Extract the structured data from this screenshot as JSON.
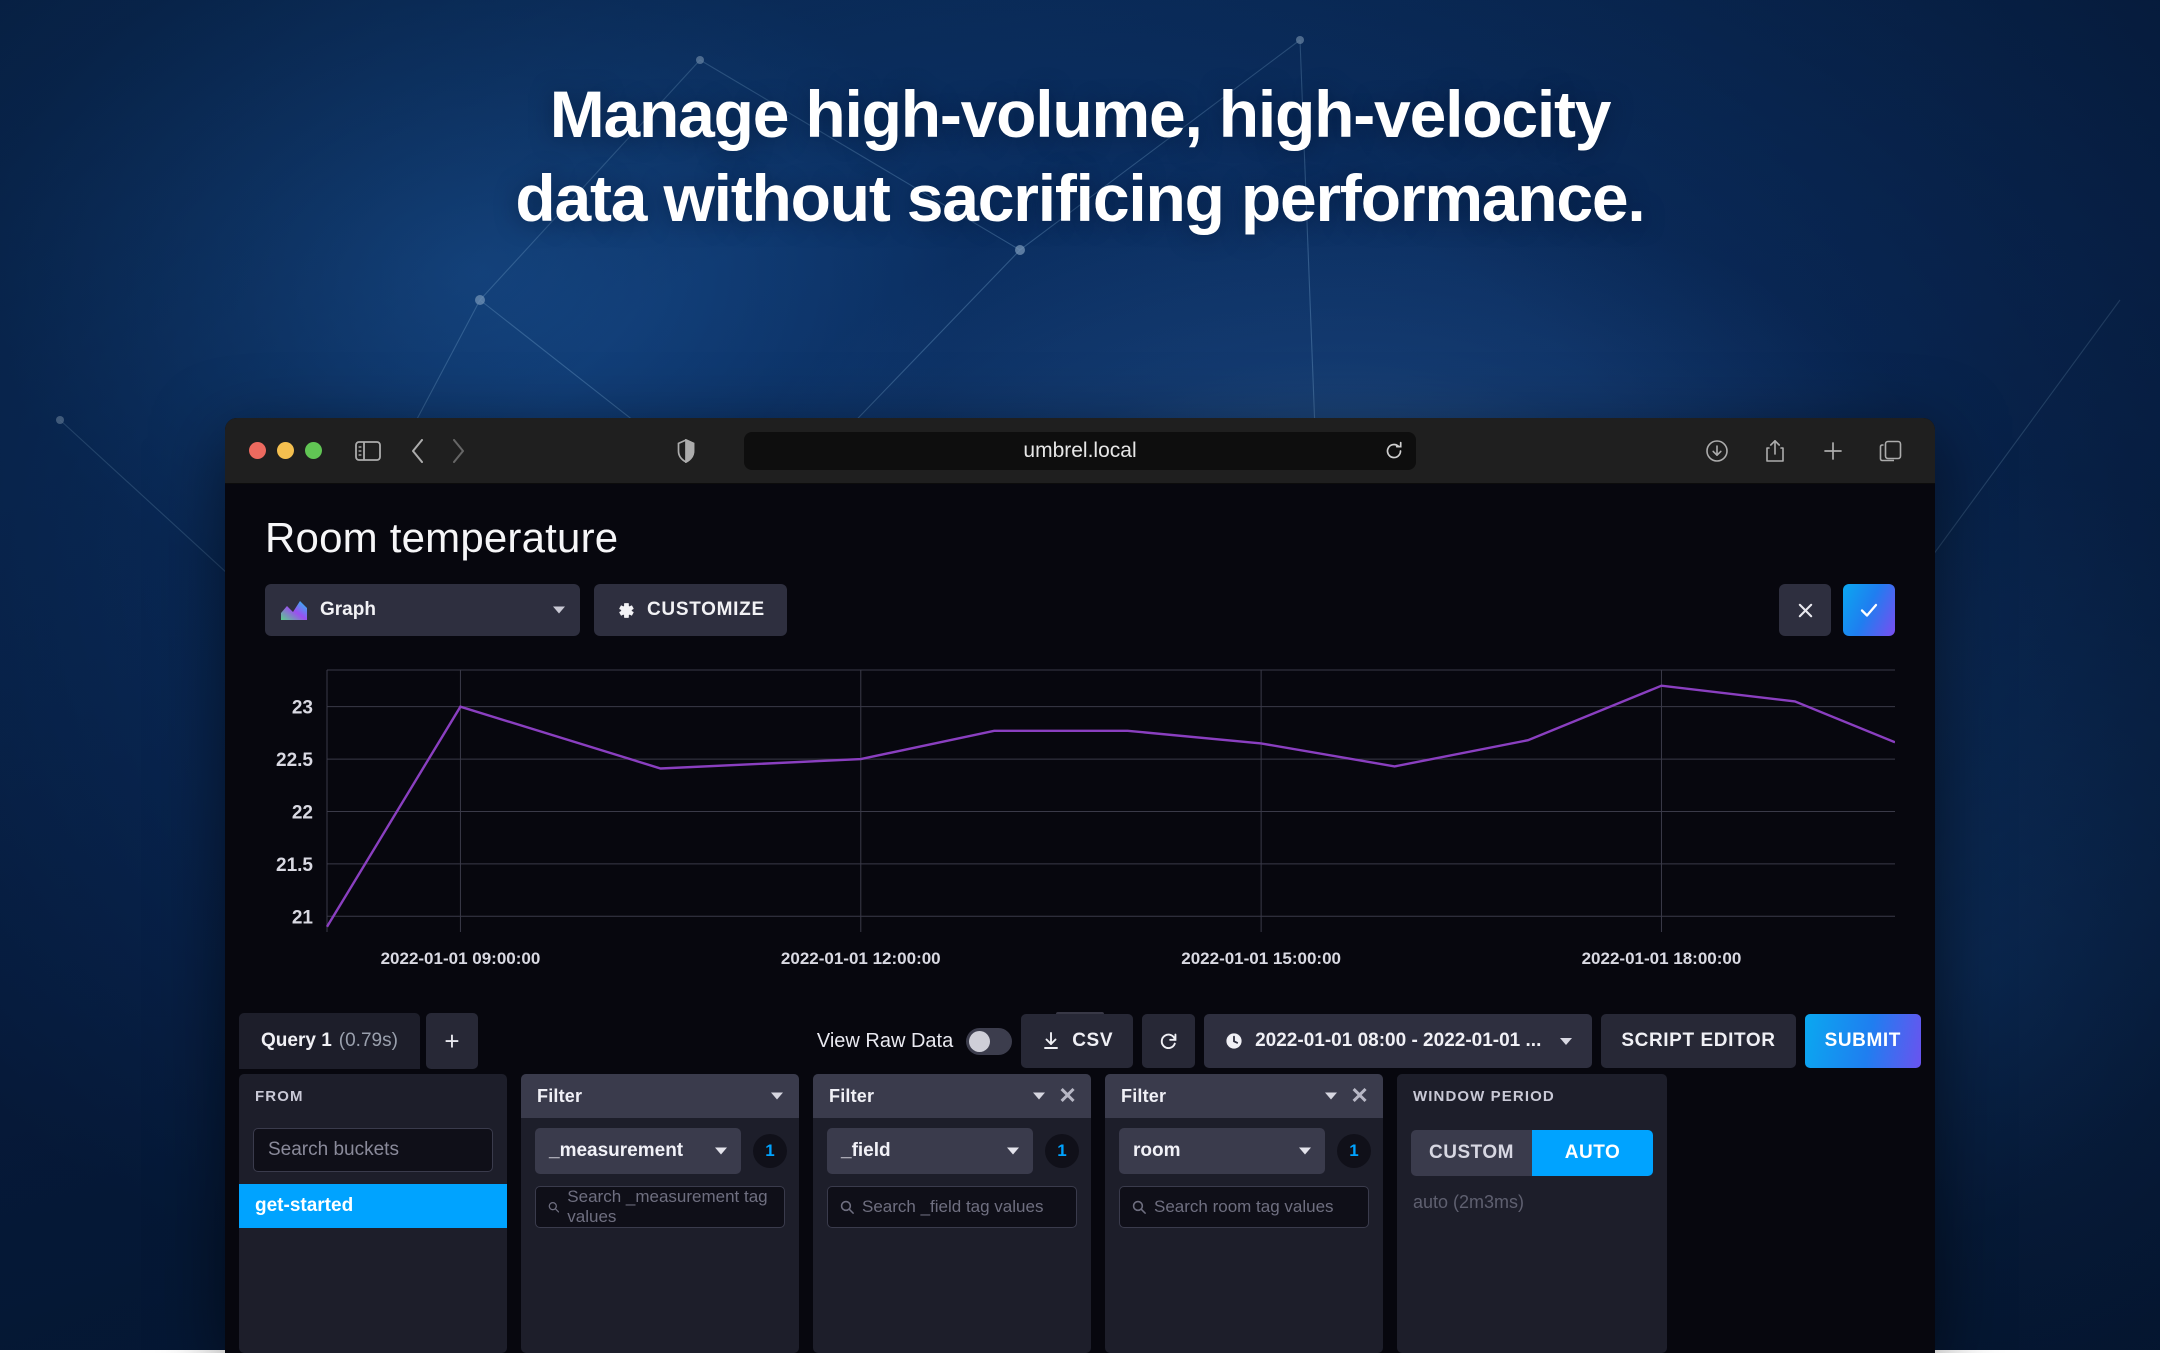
{
  "hero": {
    "headline_line1": "Manage high-volume, high-velocity",
    "headline_line2": "data without sacrificing performance."
  },
  "browser": {
    "url": "umbrel.local",
    "icons": {
      "sidebar": "sidebar-toggle-icon",
      "back": "back-arrow-icon",
      "forward": "forward-arrow-icon",
      "shield": "shield-icon",
      "reload": "reload-icon",
      "downloads": "downloads-icon",
      "share": "share-icon",
      "newtab": "plus-icon",
      "tabs": "tab-overview-icon"
    }
  },
  "app": {
    "page_title": "Room temperature",
    "visualization_type": "Graph",
    "customize_label": "CUSTOMIZE",
    "cancel_label": "×",
    "accept_label": "✓"
  },
  "query_toolbar": {
    "query_tab_label": "Query 1",
    "query_duration": "(0.79s)",
    "add_query_label": "+",
    "view_raw_data_label": "View Raw Data",
    "view_raw_data_on": false,
    "csv_label": "CSV",
    "refresh_icon": "refresh-icon",
    "time_range": "2022-01-01 08:00 - 2022-01-01 ...",
    "script_editor_label": "SCRIPT EDITOR",
    "submit_label": "SUBMIT"
  },
  "builder": {
    "from": {
      "header": "FROM",
      "search_placeholder": "Search buckets",
      "buckets": [
        "get-started"
      ]
    },
    "filters": [
      {
        "header": "Filter",
        "tag_key": "_measurement",
        "count": "1",
        "search_placeholder": "Search _measurement tag values",
        "removable": false
      },
      {
        "header": "Filter",
        "tag_key": "_field",
        "count": "1",
        "search_placeholder": "Search _field tag values",
        "removable": true
      },
      {
        "header": "Filter",
        "tag_key": "room",
        "count": "1",
        "search_placeholder": "Search room tag values",
        "removable": true
      }
    ],
    "window_period": {
      "header": "WINDOW PERIOD",
      "custom_label": "CUSTOM",
      "auto_label": "AUTO",
      "selected": "AUTO",
      "value": "auto (2m3ms)"
    }
  },
  "chart_data": {
    "type": "line",
    "title": "Room temperature",
    "xlabel": "",
    "ylabel": "",
    "grid": true,
    "legend": false,
    "line_color": "#8a3fc0",
    "ylim": [
      20.85,
      23.35
    ],
    "yticks": [
      21,
      21.5,
      22,
      22.5,
      23
    ],
    "ytick_labels": [
      "21",
      "21.5",
      "22",
      "22.5",
      "23"
    ],
    "xlim": [
      "2022-01-01 08:00:00",
      "2022-01-01 19:45:00"
    ],
    "xticks": [
      "2022-01-01 09:00:00",
      "2022-01-01 12:00:00",
      "2022-01-01 15:00:00",
      "2022-01-01 18:00:00"
    ],
    "x": [
      "2022-01-01 08:00:00",
      "2022-01-01 09:00:00",
      "2022-01-01 10:30:00",
      "2022-01-01 12:00:00",
      "2022-01-01 13:00:00",
      "2022-01-01 14:00:00",
      "2022-01-01 15:00:00",
      "2022-01-01 16:00:00",
      "2022-01-01 17:00:00",
      "2022-01-01 18:00:00",
      "2022-01-01 19:00:00",
      "2022-01-01 19:45:00"
    ],
    "values": [
      20.9,
      23.0,
      22.41,
      22.5,
      22.77,
      22.77,
      22.65,
      22.43,
      22.68,
      23.2,
      23.05,
      22.66
    ]
  }
}
